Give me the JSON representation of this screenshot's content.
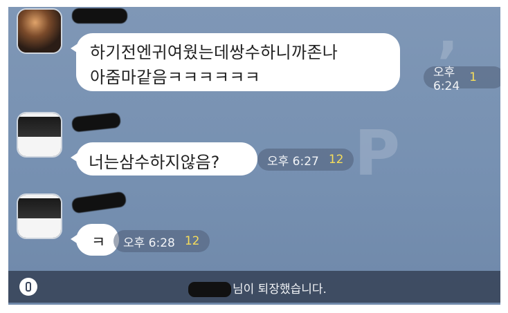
{
  "chat": {
    "messages": [
      {
        "lines": [
          "하기전엔귀여웠는데쌍수하니까존나",
          "아줌마같음ㅋㅋㅋㅋㅋㅋ"
        ],
        "time": "오후 6:24",
        "unread": "1"
      },
      {
        "lines": [
          "너는삼수하지않음?"
        ],
        "time": "오후 6:27",
        "unread": "12"
      },
      {
        "lines": [
          "ㅋ"
        ],
        "time": "오후 6:28",
        "unread": "12"
      }
    ]
  },
  "notice": {
    "text": "님이 퇴장했습니다."
  },
  "icons": {
    "exit_notice": "exit-door-icon"
  },
  "colors": {
    "background": "#7690b1",
    "bubble": "#ffffff",
    "unread": "#f7de5b",
    "notice_bar": "#3a465c"
  }
}
